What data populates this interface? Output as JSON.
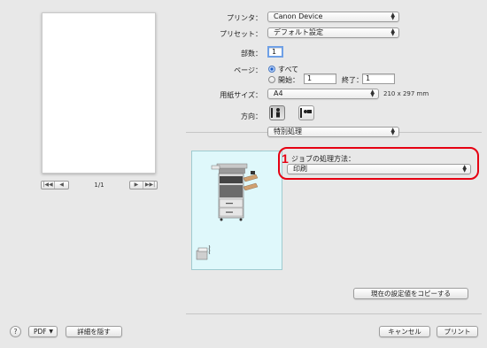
{
  "preview": {
    "pager_text": "1/1",
    "nav_buttons": [
      "|◀◀",
      "◀",
      "▶",
      "▶▶|"
    ]
  },
  "printer": {
    "label": "プリンタ：",
    "value": "Canon Device"
  },
  "preset": {
    "label": "プリセット：",
    "value": "デフォルト設定"
  },
  "copies": {
    "label": "部数：",
    "value": "1"
  },
  "pages": {
    "label": "ページ：",
    "all_label": "すべて",
    "from_label": "開始：",
    "from_value": "1",
    "to_label": "終了：",
    "to_value": "1"
  },
  "paper_size": {
    "label": "用紙サイズ：",
    "value": "A4",
    "dimensions": "210 x 297 mm"
  },
  "orientation": {
    "label": "方向：",
    "selected": "portrait"
  },
  "section_popup": {
    "value": "特別処理"
  },
  "job_processing": {
    "step_number": "1",
    "label": "ジョブの処理方法：",
    "value": "印刷"
  },
  "copy_settings_button": "現在の設定値をコピーする",
  "footer": {
    "help_icon": "?",
    "pdf_label": "PDF",
    "hide_details_label": "詳細を隠す",
    "cancel_label": "キャンセル",
    "print_label": "プリント"
  },
  "colors": {
    "callout_red": "#e60012",
    "panel_bg": "#dff8fb",
    "radio_blue": "#1f5fc8"
  }
}
